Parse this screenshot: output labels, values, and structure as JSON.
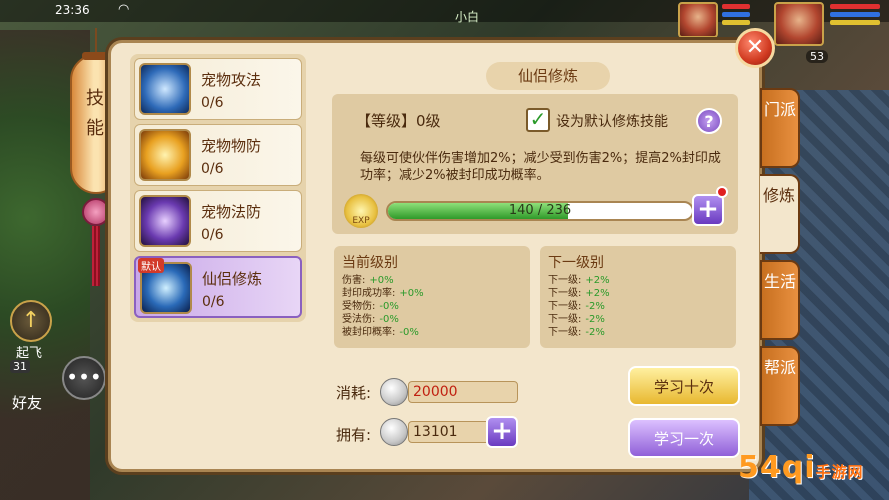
{
  "status_bar": {
    "time": "23:36",
    "player_name": "小白",
    "level": "53"
  },
  "lantern": {
    "label": "技能"
  },
  "left_ui": {
    "fly_label": "起飞",
    "friends_label": "好友",
    "chat_count": "31"
  },
  "skills": [
    {
      "name": "宠物攻法",
      "progress": "0/6",
      "badge": "",
      "selected": false
    },
    {
      "name": "宠物物防",
      "progress": "0/6",
      "badge": "",
      "selected": false
    },
    {
      "name": "宠物法防",
      "progress": "0/6",
      "badge": "",
      "selected": false
    },
    {
      "name": "仙侣修炼",
      "progress": "0/6",
      "badge": "默认",
      "selected": true
    }
  ],
  "panel": {
    "title": "仙侣修炼",
    "grade_text": "【等级】0级",
    "default_checkbox_label": "设为默认修炼技能",
    "description": "每级可使伙伴伤害增加2%；减少受到伤害2%；提高2%封印成功率；减少2%被封印成功概率。",
    "exp_icon_label": "EXP",
    "exp_text": "140 / 236",
    "exp_fraction": 0.593
  },
  "current_level": {
    "title": "当前级别",
    "rows": [
      {
        "label": "伤害:",
        "value": "+0%"
      },
      {
        "label": "封印成功率:",
        "value": "+0%"
      },
      {
        "label": "受物伤:",
        "value": "-0%"
      },
      {
        "label": "受法伤:",
        "value": "-0%"
      },
      {
        "label": "被封印概率:",
        "value": "-0%"
      }
    ]
  },
  "next_level": {
    "title": "下一级别",
    "rows": [
      {
        "label": "下一级:",
        "value": "+2%"
      },
      {
        "label": "下一级:",
        "value": "+2%"
      },
      {
        "label": "下一级:",
        "value": "-2%"
      },
      {
        "label": "下一级:",
        "value": "-2%"
      },
      {
        "label": "下一级:",
        "value": "-2%"
      }
    ]
  },
  "cost": {
    "consume_label": "消耗:",
    "consume_value": "20000",
    "own_label": "拥有:",
    "own_value": "13101"
  },
  "buttons": {
    "learn_ten": "学习十次",
    "learn_once": "学习一次"
  },
  "tabs": [
    {
      "label": "门派",
      "active": false
    },
    {
      "label": "修炼",
      "active": true
    },
    {
      "label": "生活",
      "active": false
    },
    {
      "label": "帮派",
      "active": false
    }
  ],
  "watermark": {
    "main": "54qi",
    "site": "手游网"
  },
  "colors": {
    "accent_purple": "#8a60c0",
    "panel_bg": "#f3e6cc",
    "gain_green": "#2a9a2a",
    "cost_red": "#c02010"
  }
}
